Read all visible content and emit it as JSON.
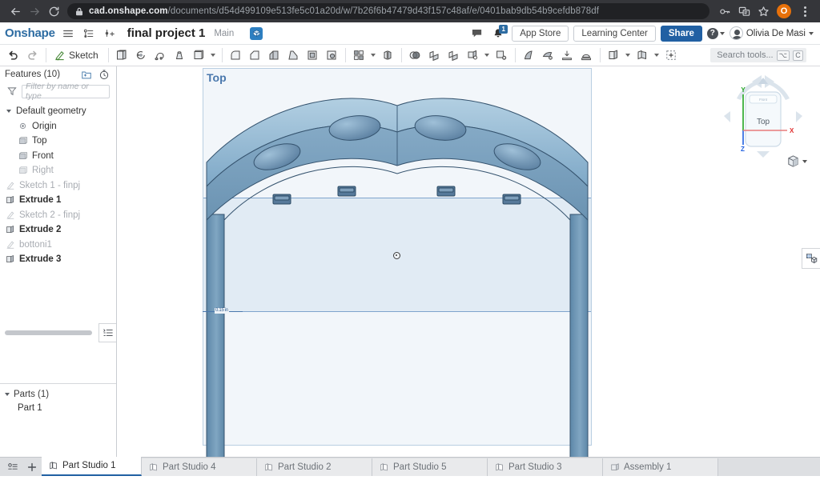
{
  "browser": {
    "back_icon": "back-arrow-icon",
    "forward_icon": "forward-arrow-icon",
    "reload_icon": "reload-icon",
    "lock_icon": "lock-icon",
    "url_host": "cad.onshape.com",
    "url_path": "/documents/d54d499109e513fe5c01a20d/w/7b26f6b47479d43f157c48af/e/0401bab9db54b9cefdb878df",
    "password_icon": "key-icon",
    "extension_icon": "extensions-icon",
    "bookmark_icon": "star-icon",
    "profile_initial": "O",
    "menu_icon": "kebab-menu-icon"
  },
  "header": {
    "brand": "Onshape",
    "menu_icon": "hamburger-menu-icon",
    "versions_icon": "version-graph-icon",
    "insert_icon": "insert-version-icon",
    "document_title": "final project 1",
    "branch": "Main",
    "workspace_badge_icon": "workspace-badge-icon",
    "comments_icon": "comment-icon",
    "notifications_icon": "bell-icon",
    "notification_count": "1",
    "app_store_label": "App Store",
    "learning_center_label": "Learning Center",
    "share_label": "Share",
    "help_label": "?",
    "user_name": "Olivia De Masi"
  },
  "toolbar": {
    "undo_icon": "undo-icon",
    "redo_icon": "redo-icon",
    "sketch_label": "Sketch",
    "sketch_icon": "sketch-pencil-icon",
    "tools": [
      {
        "name": "extrude-icon"
      },
      {
        "name": "revolve-icon"
      },
      {
        "name": "sweep-icon"
      },
      {
        "name": "loft-icon"
      },
      {
        "name": "thicken-icon"
      },
      {
        "name": "fillet-icon"
      },
      {
        "name": "chamfer-icon"
      },
      {
        "name": "draft-icon"
      },
      {
        "name": "rib-icon"
      },
      {
        "name": "shell-icon"
      },
      {
        "name": "hole-icon"
      },
      {
        "name": "pattern-icon"
      },
      {
        "name": "mirror-icon"
      },
      {
        "name": "boolean-icon"
      },
      {
        "name": "split-icon"
      },
      {
        "name": "transform-icon"
      },
      {
        "name": "move-face-icon"
      },
      {
        "name": "delete-face-icon"
      },
      {
        "name": "replace-face-icon"
      },
      {
        "name": "offset-surface-icon"
      },
      {
        "name": "enclose-icon"
      },
      {
        "name": "part-tools-icon"
      },
      {
        "name": "sheet-metal-icon"
      },
      {
        "name": "add-custom-feature-icon"
      }
    ],
    "search_placeholder": "Search tools...",
    "search_icon": "search-tools-icon",
    "shortcut_keys": [
      "⌥",
      "C"
    ]
  },
  "feature_tree": {
    "title": "Features (10)",
    "new_folder_icon": "new-folder-icon",
    "rollback_icon": "history-timer-icon",
    "filter_icon": "filter-funnel-icon",
    "filter_placeholder": "Filter by name or type",
    "items": [
      {
        "label": "Default geometry",
        "icon": "folder-icon",
        "level": 0,
        "dim": false,
        "bold": false,
        "chevron": true
      },
      {
        "label": "Origin",
        "icon": "origin-icon",
        "level": 1,
        "dim": false,
        "bold": false,
        "chevron": false
      },
      {
        "label": "Top",
        "icon": "plane-icon",
        "level": 1,
        "dim": false,
        "bold": false,
        "chevron": false
      },
      {
        "label": "Front",
        "icon": "plane-icon",
        "level": 1,
        "dim": false,
        "bold": false,
        "chevron": false
      },
      {
        "label": "Right",
        "icon": "plane-icon",
        "level": 1,
        "dim": true,
        "bold": false,
        "chevron": false
      },
      {
        "label": "Sketch 1 - finpj",
        "icon": "sketch-icon",
        "level": 0,
        "dim": true,
        "bold": false,
        "chevron": false
      },
      {
        "label": "Extrude 1",
        "icon": "extrude-feature-icon",
        "level": 0,
        "dim": false,
        "bold": true,
        "chevron": false
      },
      {
        "label": "Sketch 2 - finpj",
        "icon": "sketch-icon",
        "level": 0,
        "dim": true,
        "bold": false,
        "chevron": false
      },
      {
        "label": "Extrude 2",
        "icon": "extrude-feature-icon",
        "level": 0,
        "dim": false,
        "bold": true,
        "chevron": false
      },
      {
        "label": "bottoni1",
        "icon": "sketch-icon",
        "level": 0,
        "dim": true,
        "bold": false,
        "chevron": false
      },
      {
        "label": "Extrude 3",
        "icon": "extrude-feature-icon",
        "level": 0,
        "dim": false,
        "bold": true,
        "chevron": false
      }
    ],
    "list_view_icon": "feature-list-icon",
    "parts_title": "Parts (1)",
    "parts": [
      {
        "label": "Part 1"
      }
    ]
  },
  "viewport": {
    "plane_label": "Top",
    "origin_marker_icon": "origin-point-icon",
    "dimension_label": "0.15 in",
    "view_cube": {
      "face_label": "Top",
      "top_small_label": "Front",
      "axis_x": "X",
      "axis_y": "Y",
      "axis_z": "Z",
      "axis_x_color": "#e03030",
      "axis_y_color": "#22a522",
      "axis_z_color": "#2060e0",
      "arrow_left_icon": "rotate-left-icon",
      "arrow_right_icon": "rotate-right-icon",
      "arrow_up_icon": "rotate-up-icon",
      "arrow_down_icon": "rotate-down-icon",
      "view_select_icon": "view-orientation-cube-icon"
    },
    "right_dock_icon": "appearance-panel-icon",
    "model_colors": {
      "face_light": "#9dc0d8",
      "face_mid": "#7ba3c2",
      "face_dark": "#5d87a8",
      "edge": "#35536e"
    }
  },
  "tabbar": {
    "tab_list_icon": "tab-list-icon",
    "add_tab_icon": "add-tab-icon",
    "tabs": [
      {
        "label": "Part Studio 1",
        "icon": "part-studio-icon",
        "active": true
      },
      {
        "label": "Part Studio 4",
        "icon": "part-studio-icon",
        "active": false
      },
      {
        "label": "Part Studio 2",
        "icon": "part-studio-icon",
        "active": false
      },
      {
        "label": "Part Studio 5",
        "icon": "part-studio-icon",
        "active": false
      },
      {
        "label": "Part Studio 3",
        "icon": "part-studio-icon",
        "active": false
      },
      {
        "label": "Assembly 1",
        "icon": "assembly-icon",
        "active": false
      }
    ]
  }
}
